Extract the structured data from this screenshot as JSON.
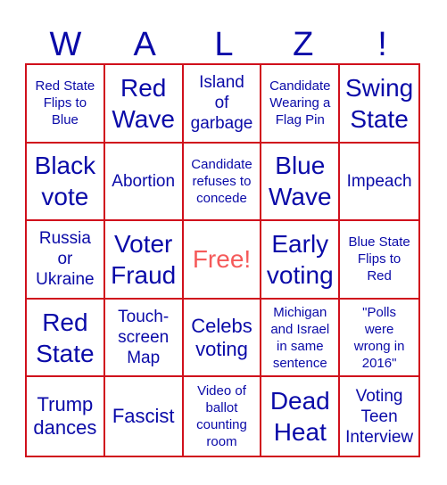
{
  "header": {
    "letters": [
      "W",
      "A",
      "L",
      "Z",
      "!"
    ]
  },
  "colors": {
    "text": "#0a0aa8",
    "grid": "#d0101c",
    "free": "#f55a5a"
  },
  "cells": [
    {
      "text": "Red State\nFlips to\nBlue",
      "size": "sm"
    },
    {
      "text": "Red\nWave",
      "size": "xl"
    },
    {
      "text": "Island\nof\ngarbage",
      "size": "md"
    },
    {
      "text": "Candidate\nWearing a\nFlag Pin",
      "size": "sm"
    },
    {
      "text": "Swing\nState",
      "size": "xl"
    },
    {
      "text": "Black\nvote",
      "size": "xl"
    },
    {
      "text": "Abortion",
      "size": "md"
    },
    {
      "text": "Candidate\nrefuses to\nconcede",
      "size": "sm"
    },
    {
      "text": "Blue\nWave",
      "size": "xl"
    },
    {
      "text": "Impeach",
      "size": "md"
    },
    {
      "text": "Russia\nor\nUkraine",
      "size": "md"
    },
    {
      "text": "Voter\nFraud",
      "size": "xl"
    },
    {
      "text": "Free!",
      "size": "free"
    },
    {
      "text": "Early\nvoting",
      "size": "xl"
    },
    {
      "text": "Blue State\nFlips to\nRed",
      "size": "sm"
    },
    {
      "text": "Red\nState",
      "size": "xl"
    },
    {
      "text": "Touch-\nscreen\nMap",
      "size": "md"
    },
    {
      "text": "Celebs\nvoting",
      "size": "lg"
    },
    {
      "text": "Michigan\nand Israel\nin same\nsentence",
      "size": "sm"
    },
    {
      "text": "\"Polls\nwere\nwrong in\n2016\"",
      "size": "sm"
    },
    {
      "text": "Trump\ndances",
      "size": "lg"
    },
    {
      "text": "Fascist",
      "size": "lg"
    },
    {
      "text": "Video of\nballot\ncounting\nroom",
      "size": "sm"
    },
    {
      "text": "Dead\nHeat",
      "size": "xl"
    },
    {
      "text": "Voting\nTeen\nInterview",
      "size": "md"
    }
  ]
}
